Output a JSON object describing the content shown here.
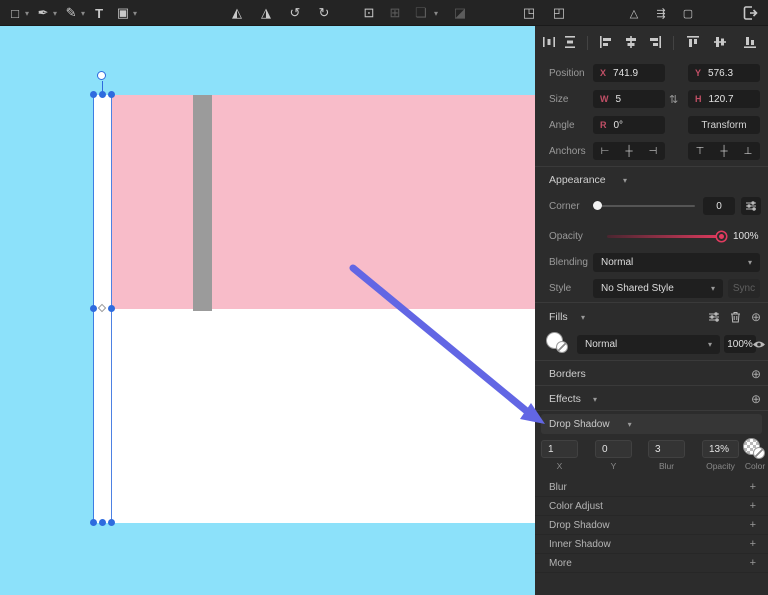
{
  "toolbar": {
    "icons": {
      "rect_tool": "□",
      "pen_tool": "✒",
      "pencil_tool": "✎",
      "text_tool": "T",
      "image_tool": "▣",
      "chevron": "▾",
      "flip_horizontal": "◭",
      "flip_vertical": "◮",
      "rotate_ccw": "↺",
      "rotate_cw": "↻",
      "fit_selection": "⊡",
      "fit_canvas": "⊞",
      "boolean_ops": "❏",
      "mask": "◪",
      "rotate_copy": "◳",
      "rotate_instance": "◰",
      "vectorize": "△",
      "connector": "⇶",
      "frame": "▢"
    }
  },
  "panel": {
    "position": {
      "label": "Position",
      "x_key": "X",
      "x_value": "741.9",
      "y_key": "Y",
      "y_value": "576.3"
    },
    "size": {
      "label": "Size",
      "w_key": "W",
      "w_value": "5",
      "h_key": "H",
      "h_value": "120.7",
      "lock_icon": "⇅"
    },
    "angle": {
      "label": "Angle",
      "r_key": "R",
      "r_value": "0°",
      "transform_label": "Transform"
    },
    "anchors": {
      "label": "Anchors",
      "h_icons": [
        "⊢",
        "┼",
        "⊣"
      ],
      "v_icons": [
        "⊤",
        "┼",
        "⊥"
      ]
    },
    "appearance": {
      "title": "Appearance",
      "corner_label": "Corner",
      "corner_value": "0",
      "opacity_label": "Opacity",
      "opacity_value": "100%",
      "blending_label": "Blending",
      "blending_value": "Normal",
      "style_label": "Style",
      "style_value": "No Shared Style",
      "sync_label": "Sync"
    },
    "fills": {
      "title": "Fills",
      "blend_mode": "Normal",
      "opacity": "100%"
    },
    "borders": {
      "title": "Borders"
    },
    "effects": {
      "title": "Effects"
    },
    "drop_shadow": {
      "title": "Drop Shadow",
      "x_value": "1",
      "y_value": "0",
      "blur_value": "3",
      "opacity_value": "13%",
      "x_label": "X",
      "y_label": "Y",
      "blur_label": "Blur",
      "opacity_label": "Opacity",
      "color_label": "Color"
    },
    "effect_list": [
      {
        "label": "Blur",
        "plus": "+"
      },
      {
        "label": "Color Adjust",
        "plus": "+"
      },
      {
        "label": "Drop Shadow",
        "plus": "+"
      },
      {
        "label": "Inner Shadow",
        "plus": "+"
      },
      {
        "label": "More",
        "plus": "+"
      }
    ],
    "icons": {
      "plus_circle": "⊕",
      "chevron": "▾"
    }
  },
  "canvas": {
    "colors": {
      "background": "#8CE1FA",
      "flag_pink": "#F8BCC9",
      "flag_white": "#FFFFFF",
      "stripe_gray": "#9B9B9B",
      "selection_blue": "#2E6BDE",
      "arrow_blue": "#6266E4",
      "accent_red": "#C14F66",
      "slider_red": "#E23B5F"
    }
  }
}
